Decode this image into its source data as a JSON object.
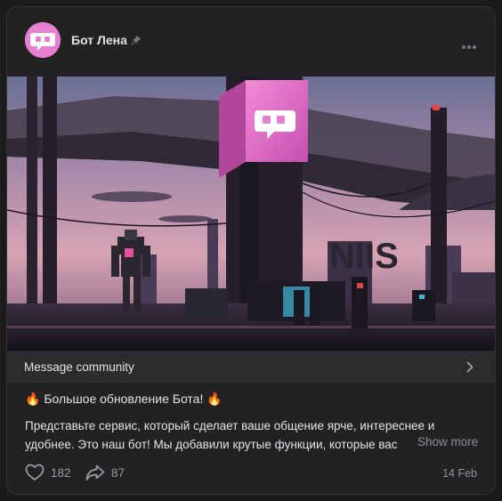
{
  "post": {
    "author": "Бот Лена",
    "pin_icon": "pin-icon",
    "more_icon": "more-dots-icon",
    "community_link": "Message community",
    "title": "🔥 Большое обновление Бота! 🔥",
    "body_line1": "Представьте сервис, который сделает ваше общение ярче, интереснее и",
    "body_line2": "удобнее. Это наш бот! Мы добавили крутые функции, которые вас",
    "show_more": "Show more",
    "likes": "182",
    "shares": "87",
    "date": "14 Feb",
    "sign_text": "NIIS"
  },
  "colors": {
    "accent_pink": "#e87fd0",
    "background": "#222224",
    "community_bar": "#2c2c2e"
  }
}
